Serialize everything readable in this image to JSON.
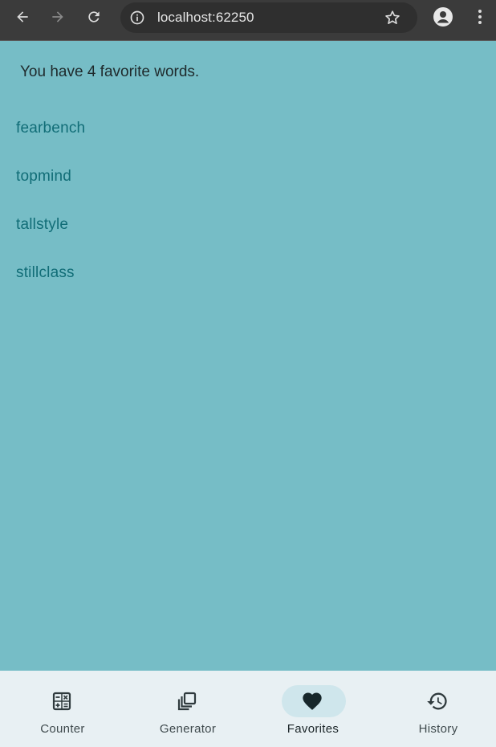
{
  "browser": {
    "url": "localhost:62250",
    "icons": {
      "back": "arrow-left-icon",
      "forward": "arrow-right-icon",
      "reload": "reload-icon",
      "site_info": "info-icon",
      "bookmark": "star-icon",
      "account": "account-icon",
      "menu": "kebab-menu-icon"
    }
  },
  "main": {
    "summary": "You have 4 favorite words.",
    "favorites": [
      "fearbench",
      "topmind",
      "tallstyle",
      "stillclass"
    ]
  },
  "bottom_nav": {
    "items": [
      {
        "label": "Counter",
        "icon": "calculator-icon",
        "selected": false
      },
      {
        "label": "Generator",
        "icon": "filter-none-icon",
        "selected": false
      },
      {
        "label": "Favorites",
        "icon": "heart-icon",
        "selected": true
      },
      {
        "label": "History",
        "icon": "history-icon",
        "selected": false
      }
    ]
  },
  "colors": {
    "page_background": "#76bdc6",
    "word_text": "#116d77",
    "nav_background": "#e8f0f3",
    "nav_indicator": "#cfe6ec",
    "browser_bar": "#3b3b3b"
  }
}
